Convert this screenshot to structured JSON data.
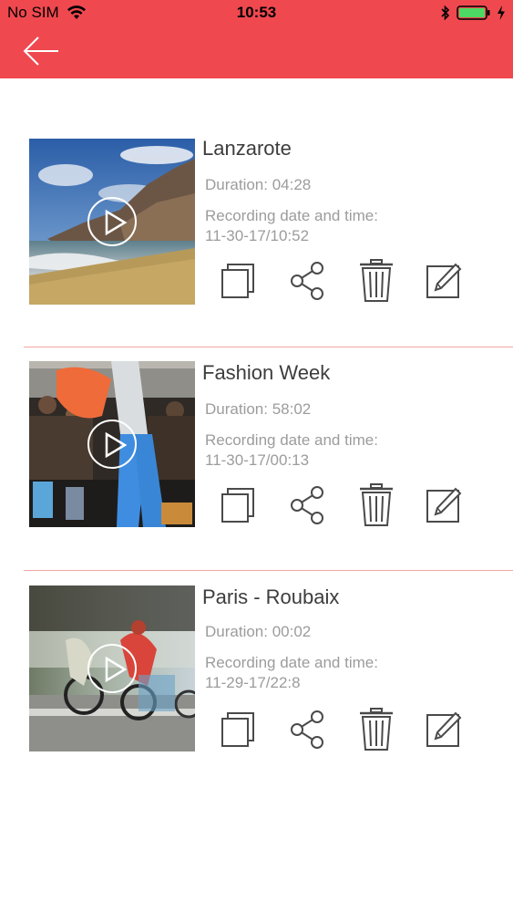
{
  "status_bar": {
    "carrier": "No SIM",
    "time": "10:53"
  },
  "nav": {
    "back_icon": "back-arrow-icon",
    "color": "#f0484f"
  },
  "videos": [
    {
      "title": "Lanzarote",
      "duration": "Duration: 04:28",
      "recording_label": "Recording date and time:",
      "recording_value": "11-30-17/10:52"
    },
    {
      "title": "Fashion Week",
      "duration": "Duration: 58:02",
      "recording_label": "Recording date and time:",
      "recording_value": "11-30-17/00:13"
    },
    {
      "title": "Paris - Roubaix",
      "duration": "Duration: 00:02",
      "recording_label": "Recording date and time:",
      "recording_value": "11-29-17/22:8"
    }
  ],
  "actions": [
    "copy-icon",
    "share-icon",
    "trash-icon",
    "edit-icon"
  ]
}
